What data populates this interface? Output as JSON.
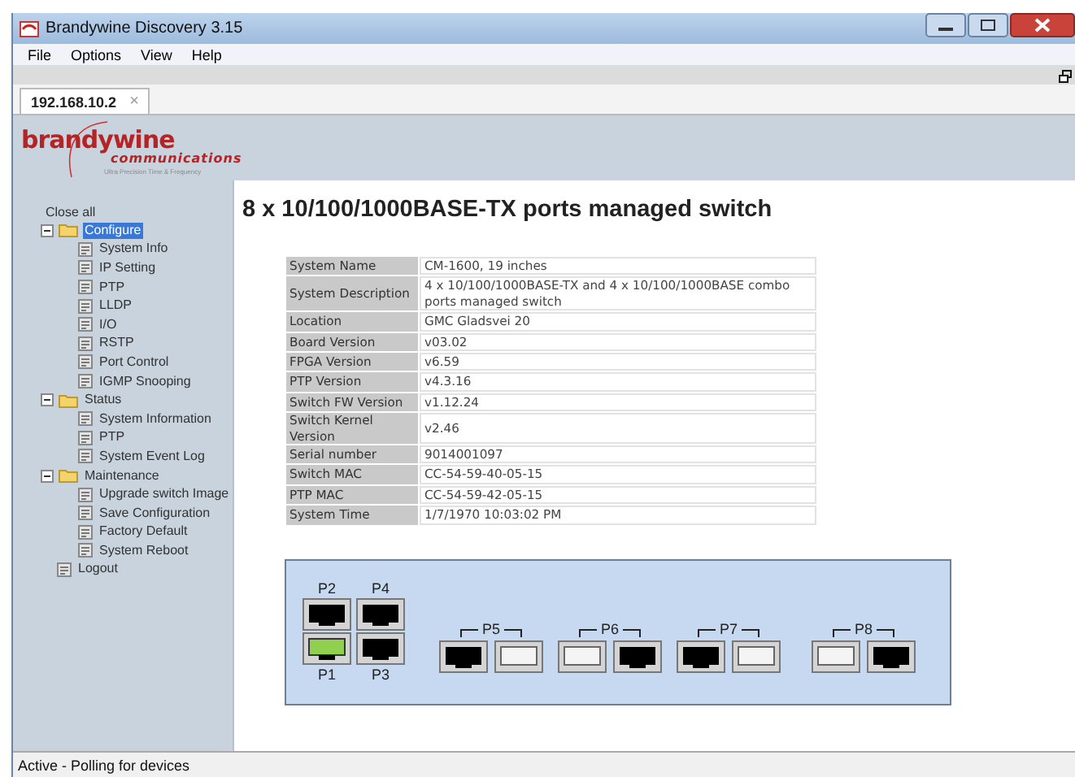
{
  "window": {
    "title": "Brandywine Discovery 3.15"
  },
  "menu": [
    "File",
    "Options",
    "View",
    "Help"
  ],
  "tabs": [
    {
      "label": "192.168.10.2",
      "selected": true,
      "close": "×"
    }
  ],
  "logo": {
    "name": "brandywine",
    "subtitle": "communications",
    "tagline": "Ultra Precision Time & Frequency"
  },
  "sidebar": {
    "close_all": "Close all",
    "tree": [
      {
        "label": "Configure",
        "selected": true,
        "expanded": true,
        "children": [
          {
            "label": "System Info",
            "selected": false
          },
          {
            "label": "IP Setting",
            "selected": false
          },
          {
            "label": "PTP",
            "selected": false
          },
          {
            "label": "LLDP",
            "selected": false
          },
          {
            "label": "I/O",
            "selected": false
          },
          {
            "label": "RSTP",
            "selected": false
          },
          {
            "label": "Port Control",
            "selected": false
          },
          {
            "label": "IGMP Snooping",
            "selected": false
          }
        ]
      },
      {
        "label": "Status",
        "selected": false,
        "expanded": true,
        "children": [
          {
            "label": "System Information",
            "selected": false
          },
          {
            "label": "PTP",
            "selected": false
          },
          {
            "label": "System Event Log",
            "selected": false
          }
        ]
      },
      {
        "label": "Maintenance",
        "selected": false,
        "expanded": true,
        "children": [
          {
            "label": "Upgrade switch Image",
            "selected": false
          },
          {
            "label": "Save Configuration",
            "selected": false
          },
          {
            "label": "Factory Default",
            "selected": false
          },
          {
            "label": "System Reboot",
            "selected": false
          }
        ]
      },
      {
        "label": "Logout",
        "selected": false
      }
    ]
  },
  "heading": "8 x 10/100/1000BASE-TX ports managed switch",
  "info_table": [
    [
      "System Name",
      "CM-1600, 19 inches"
    ],
    [
      "System Description",
      "4 x 10/100/1000BASE-TX and 4 x 10/100/1000BASE combo ports managed switch"
    ],
    [
      "Location",
      "GMC Gladsvei 20"
    ],
    [
      "Board Version",
      "v03.02"
    ],
    [
      "FPGA Version",
      "v6.59"
    ],
    [
      "PTP Version",
      "v4.3.16"
    ],
    [
      "Switch FW Version",
      "v1.12.24"
    ],
    [
      "Switch Kernel Version",
      "v2.46"
    ],
    [
      "Serial number",
      "9014001097"
    ],
    [
      "Switch MAC",
      "CC-54-59-40-05-15"
    ],
    [
      "PTP MAC",
      "CC-54-59-42-05-15"
    ],
    [
      "System Time",
      "1/7/1970 10:03:02 PM"
    ]
  ],
  "port_block": {
    "top": [
      {
        "label": "P2",
        "link": false
      },
      {
        "label": "P4",
        "link": false
      }
    ],
    "bottom": [
      {
        "label": "P1",
        "link": true
      },
      {
        "label": "P3",
        "link": false
      }
    ]
  },
  "combo_ports": [
    {
      "label": "P5",
      "slots": [
        {
          "kind": "rj45"
        },
        {
          "kind": "sfp"
        }
      ]
    },
    {
      "label": "P6",
      "slots": [
        {
          "kind": "sfp"
        },
        {
          "kind": "rj45"
        }
      ]
    },
    {
      "label": "P7",
      "slots": [
        {
          "kind": "rj45"
        },
        {
          "kind": "sfp"
        }
      ]
    },
    {
      "label": "P8",
      "slots": [
        {
          "kind": "sfp"
        },
        {
          "kind": "rj45"
        }
      ]
    }
  ],
  "status_bar": "Active - Polling for devices"
}
